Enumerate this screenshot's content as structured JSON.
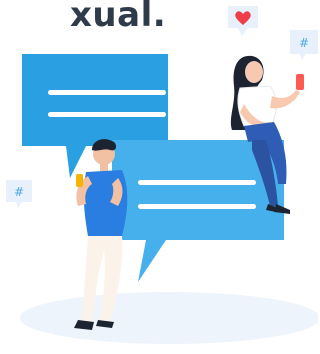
{
  "header": {
    "title": "xual."
  },
  "badges": {
    "left_hash": "#",
    "right_hash": "#"
  },
  "colors": {
    "bubble_back": "#2aa0e3",
    "bubble_front": "#46b0ec",
    "bubble_line": "#ffffff",
    "shadow": "#eef4fb",
    "heart": "#ef3d4a",
    "phone": "#ff5a52",
    "man_shirt": "#2a7de1",
    "woman_jeans": "#2f5db5"
  },
  "icons": [
    "heart-icon",
    "hashtag-icon",
    "hashtag-icon"
  ]
}
